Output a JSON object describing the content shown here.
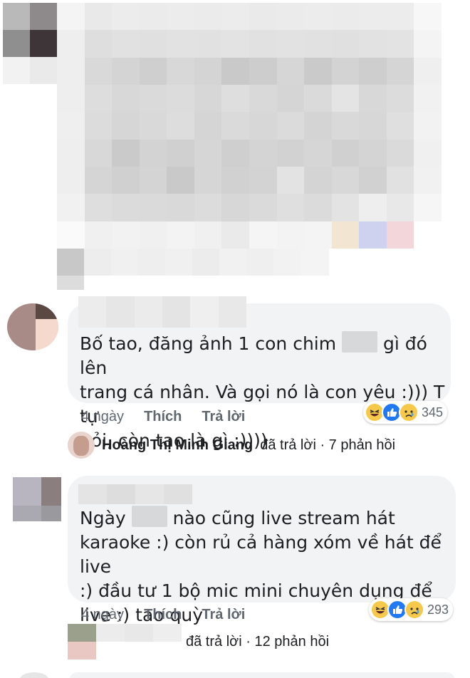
{
  "comments": [
    {
      "text_line1_a": "Bố tao, đăng ảnh 1 con chim",
      "text_line1_b": "gì đó lên",
      "text_line2": "trang cá nhân. Và gọi nó là con yêu :))) T tự",
      "text_line3": "hỏi, còn tao là gì :))))",
      "time": "4 ngày",
      "like_label": "Thích",
      "reply_label": "Trả lời",
      "reaction_count": "345",
      "reactions": [
        "haha-icon",
        "like-icon",
        "sad-icon"
      ]
    },
    {
      "text_line1_a": "Ngày",
      "text_line1_b": "nào cũng live stream hát",
      "text_line2": "karaoke :) còn rủ cả hàng xóm về hát để live",
      "text_line3": ":) đầu tư 1 bộ mic mini chuyên dụng để",
      "text_line4": "live :) tao quỳ",
      "time": "4 ngày",
      "like_label": "Thích",
      "reply_label": "Trả lời",
      "reaction_count": "293",
      "reactions": [
        "haha-icon",
        "like-icon",
        "sad-icon"
      ]
    }
  ],
  "replies": [
    {
      "name": "Hoàng Thị Minh Giang",
      "status": "đã trả lời · 7 phản hồi"
    },
    {
      "name": "",
      "status": "đã trả lời · 12 phản hồi"
    }
  ],
  "colors": {
    "bubble": "#f2f3f5",
    "meta_text": "#606770",
    "like_blue": "#2078f4",
    "haha_yellow": "#f7c94a"
  }
}
